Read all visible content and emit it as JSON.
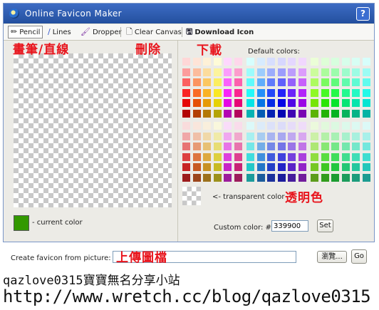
{
  "window": {
    "title": "Online Favicon Maker",
    "help_label": "?"
  },
  "toolbar": {
    "pencil_label": "Pencil",
    "lines_label": "Lines",
    "dropper_label": "Dropper",
    "clear_label": "Clear Canvas",
    "download_label": "Download Icon"
  },
  "annotations": {
    "pencil_lines": "畫筆/直線",
    "delete": "刪除",
    "download": "下載",
    "transparent": "透明色",
    "upload": "上傳圖檔"
  },
  "canvas": {
    "current_color": "#339900",
    "current_color_label": "- current color"
  },
  "palette": {
    "default_colors_label": "Default colors:",
    "transparent_label": "<- transparent color",
    "custom_color_label": "Custom color: #",
    "custom_color_value": "339900",
    "set_label": "Set"
  },
  "upload": {
    "create_label": "Create favicon from picture:",
    "browse_label": "瀏覽...",
    "go_label": "Go"
  },
  "caption": {
    "line1": "qazlove0315寶寶無名分享小站",
    "line2": "http://www.wretch.cc/blog/qazlove0315"
  }
}
